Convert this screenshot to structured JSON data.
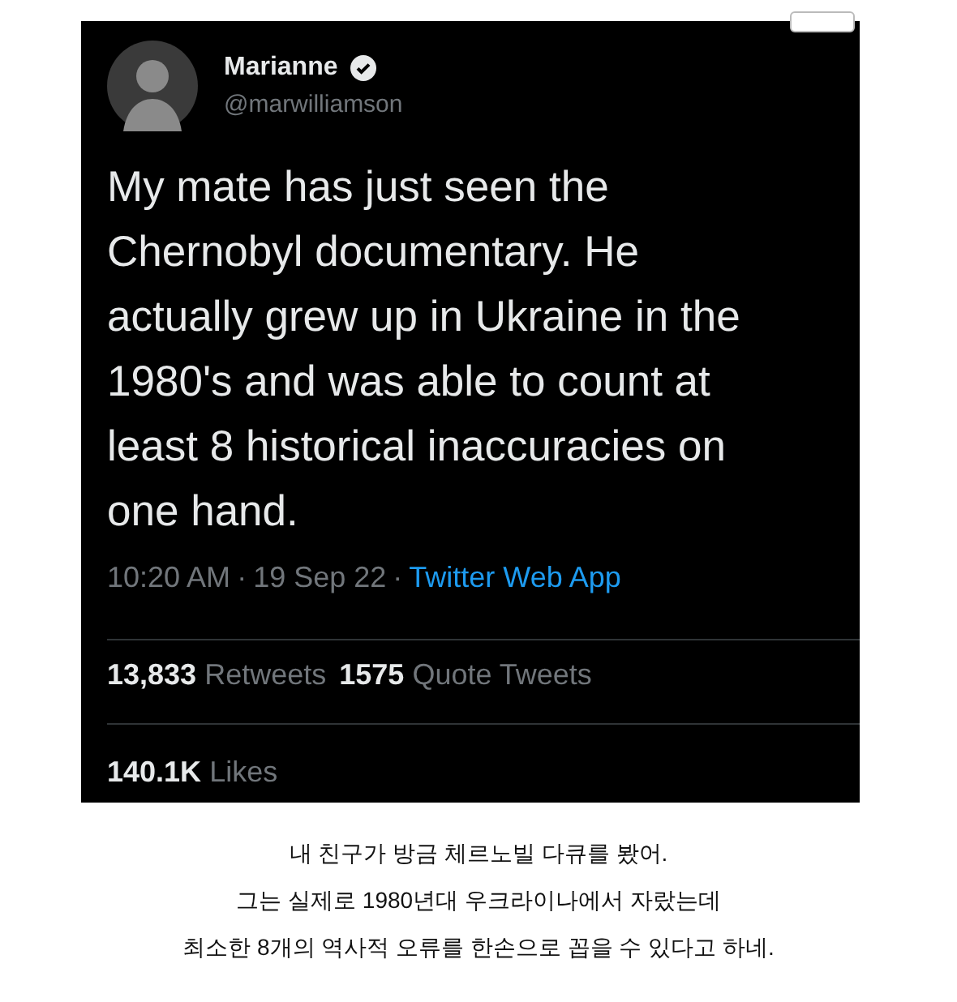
{
  "tweet": {
    "name": "Marianne",
    "verified": true,
    "handle": "@marwilliamson",
    "text": [
      "My mate has just seen the",
      "Chernobyl documentary. He",
      "actually grew up in Ukraine in the",
      "1980's and was able to count at",
      "least 8 historical inaccuracies on",
      "one hand."
    ],
    "time": "10:20 AM",
    "separator_1": "·",
    "date": "19 Sep 22",
    "separator_2": "·",
    "source": "Twitter Web App",
    "stats": [
      {
        "count": "13,833",
        "label": "Retweets"
      },
      {
        "count": "1575",
        "label": "Quote Tweets"
      }
    ],
    "likes": {
      "count": "140.1K",
      "label": "Likes"
    }
  },
  "caption": [
    "내 친구가 방금 체르노빌 다큐를 봤어.",
    "그는 실제로 1980년대 우크라이나에서 자랐는데",
    "최소한 8개의 역사적 오류를 한손으로 꼽을 수 있다고 하네."
  ]
}
